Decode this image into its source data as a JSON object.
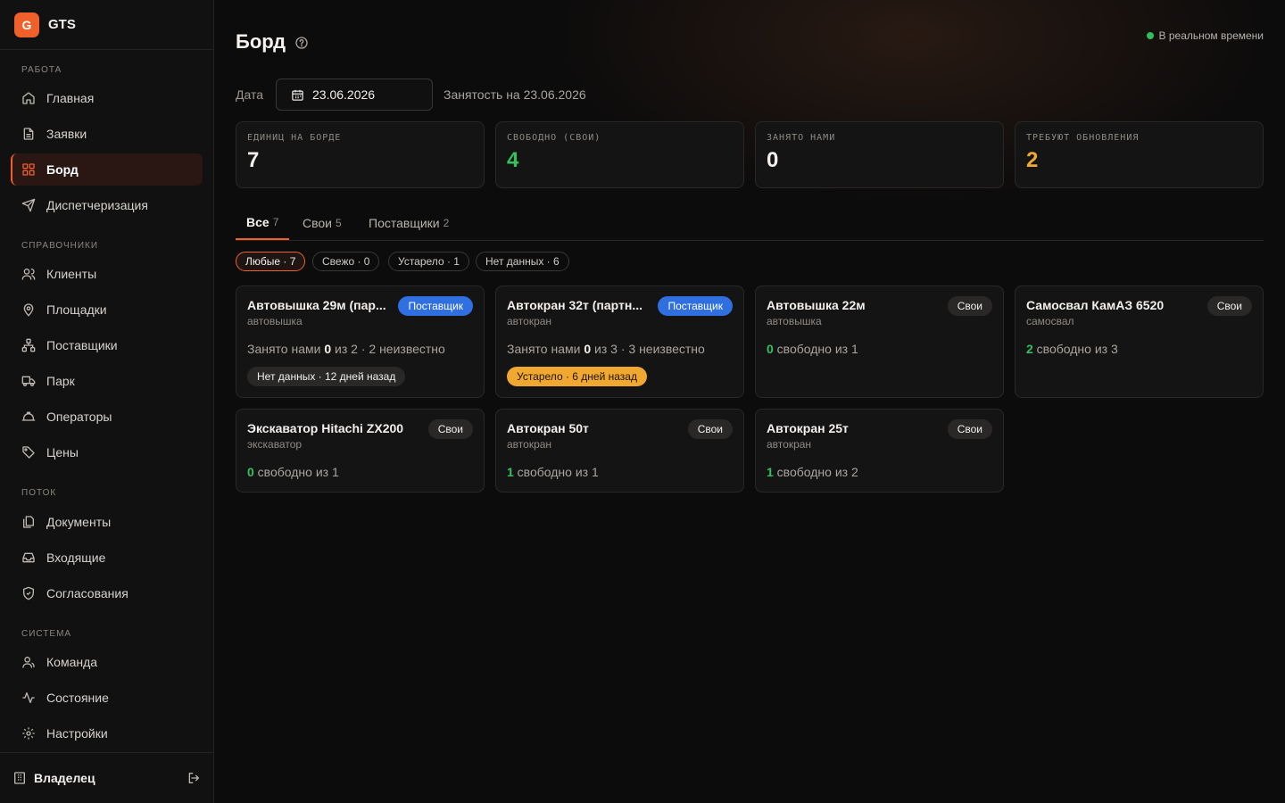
{
  "brand": {
    "logo_letter": "G",
    "name": "GTS",
    "accent": "#f0602a"
  },
  "sidebar": {
    "sections": [
      {
        "label": "РАБОТА"
      },
      {
        "label": "СПРАВОЧНИКИ"
      },
      {
        "label": "ПОТОК"
      },
      {
        "label": "СИСТЕМА"
      }
    ],
    "items": [
      {
        "label": "Главная",
        "icon": "home-icon"
      },
      {
        "label": "Заявки",
        "icon": "document-icon"
      },
      {
        "label": "Борд",
        "icon": "grid-icon",
        "active": true
      },
      {
        "label": "Диспетчеризация",
        "icon": "send-icon"
      },
      {
        "label": "Клиенты",
        "icon": "users-icon"
      },
      {
        "label": "Площадки",
        "icon": "map-pin-icon"
      },
      {
        "label": "Поставщики",
        "icon": "network-icon"
      },
      {
        "label": "Парк",
        "icon": "truck-icon"
      },
      {
        "label": "Операторы",
        "icon": "hardhat-icon"
      },
      {
        "label": "Цены",
        "icon": "tag-icon"
      },
      {
        "label": "Документы",
        "icon": "files-icon"
      },
      {
        "label": "Входящие",
        "icon": "inbox-icon"
      },
      {
        "label": "Согласования",
        "icon": "shield-check-icon"
      },
      {
        "label": "Команда",
        "icon": "team-icon"
      },
      {
        "label": "Состояние",
        "icon": "activity-icon"
      },
      {
        "label": "Настройки",
        "icon": "gear-icon"
      }
    ],
    "footer": {
      "user": "Владелец",
      "icon": "building-icon",
      "logout_icon": "logout-icon"
    }
  },
  "header": {
    "title": "Борд",
    "live_label": "В реальном времени",
    "live_color": "#2fbf5a"
  },
  "filter": {
    "date_label": "Дата",
    "date_value": "23.06.2026",
    "occupancy": "Занятость на 23.06.2026"
  },
  "stats": [
    {
      "label": "ЕДИНИЦ НА БОРДЕ",
      "value": "7",
      "color": "default"
    },
    {
      "label": "СВОБОДНО (СВОИ)",
      "value": "4",
      "color": "green"
    },
    {
      "label": "ЗАНЯТО НАМИ",
      "value": "0",
      "color": "default"
    },
    {
      "label": "ТРЕБУЮТ ОБНОВЛЕНИЯ",
      "value": "2",
      "color": "orange"
    }
  ],
  "tabs": [
    {
      "label": "Все",
      "count": "7",
      "active": true
    },
    {
      "label": "Свои",
      "count": "5"
    },
    {
      "label": "Поставщики",
      "count": "2"
    }
  ],
  "chips": [
    {
      "label": "Любые · 7",
      "active": true
    },
    {
      "label": "Свежо · 0"
    },
    {
      "label": "Устарело · 1"
    },
    {
      "label": "Нет данных · 6"
    }
  ],
  "cards": [
    {
      "title": "Автовышка 29м (пар...",
      "type": "автовышка",
      "badge": "Поставщик",
      "badge_kind": "supplier",
      "line_pre": "Занято нами ",
      "line_num": "0",
      "line_post": " из 2 · 2 неизвестно",
      "num_style": "n",
      "status": "Нет данных · 12 дней назад",
      "status_kind": "nodata"
    },
    {
      "title": "Автокран 32т (партн...",
      "type": "автокран",
      "badge": "Поставщик",
      "badge_kind": "supplier",
      "line_pre": "Занято нами ",
      "line_num": "0",
      "line_post": " из 3 · 3 неизвестно",
      "num_style": "n",
      "status": "Устарело · 6 дней назад",
      "status_kind": "stale"
    },
    {
      "title": "Автовышка 22м",
      "type": "автовышка",
      "badge": "Свои",
      "badge_kind": "own",
      "line_pre": "",
      "line_num": "0",
      "line_post": " свободно из 1",
      "num_style": "g"
    },
    {
      "title": "Самосвал КамАЗ 6520",
      "type": "самосвал",
      "badge": "Свои",
      "badge_kind": "own",
      "line_pre": "",
      "line_num": "2",
      "line_post": " свободно из 3",
      "num_style": "g"
    },
    {
      "title": "Экскаватор Hitachi ZX200",
      "type": "экскаватор",
      "badge": "Свои",
      "badge_kind": "own",
      "line_pre": "",
      "line_num": "0",
      "line_post": " свободно из 1",
      "num_style": "g"
    },
    {
      "title": "Автокран 50т",
      "type": "автокран",
      "badge": "Свои",
      "badge_kind": "own",
      "line_pre": "",
      "line_num": "1",
      "line_post": " свободно из 1",
      "num_style": "g"
    },
    {
      "title": "Автокран 25т",
      "type": "автокран",
      "badge": "Свои",
      "badge_kind": "own",
      "line_pre": "",
      "line_num": "1",
      "line_post": " свободно из 2",
      "num_style": "g"
    }
  ]
}
